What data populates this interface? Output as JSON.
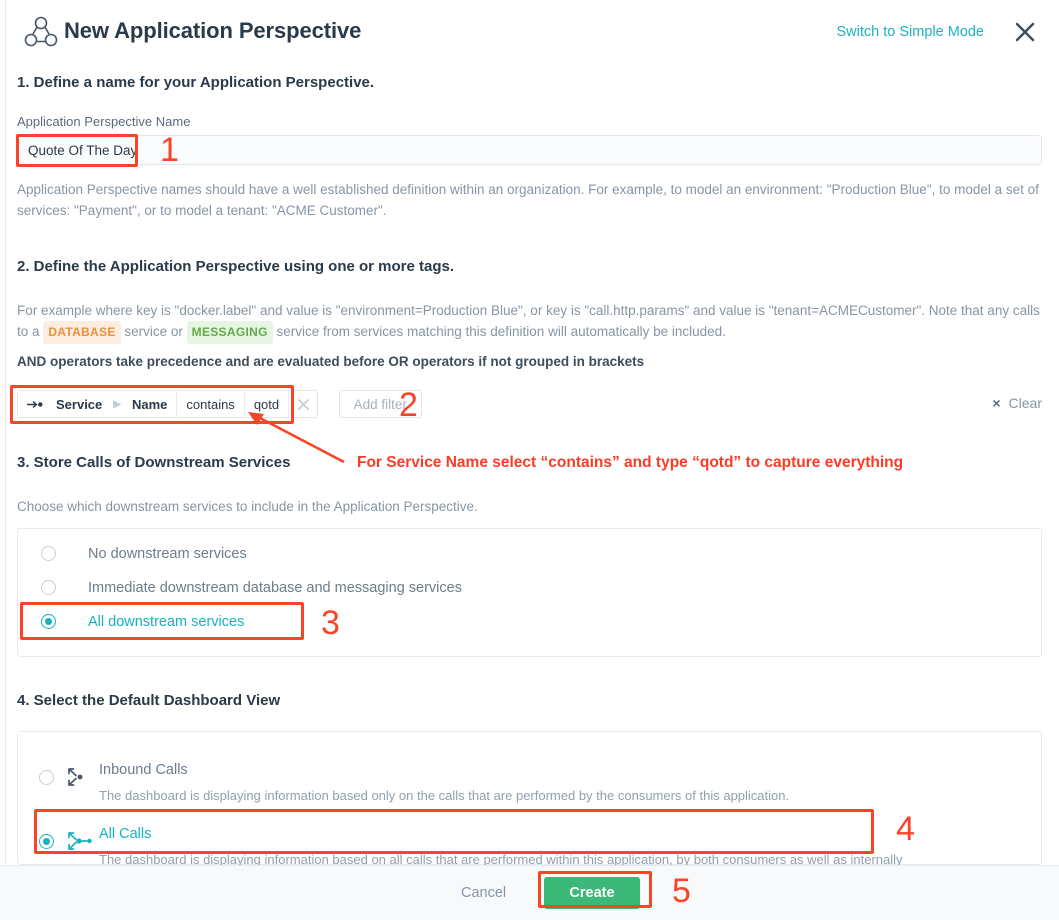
{
  "header": {
    "icon": "perspective-nodes-icon",
    "title": "New Application Perspective",
    "switch_mode_label": "Switch to Simple Mode",
    "close_label": "×"
  },
  "step1": {
    "title": "1. Define a name for your Application Perspective.",
    "field_label": "Application Perspective Name",
    "name_value": "Quote Of The Day",
    "name_placeholder": "Application Perspective Name",
    "helper_line1": "Application Perspective names should have a well established definition within an organization. For example, to model an environment: \"Production Blue\", to model a set of",
    "helper_line2": "services: \"Payment\", or to model a tenant: \"ACME Customer\"."
  },
  "step2": {
    "title": "2. Define the Application Perspective using one or more tags.",
    "helper_a": "For example where key is \"docker.label\" and value is \"environment=Production Blue\", or key is \"call.http.params\" and value is \"tenant=ACMECustomer\". Note that any calls to",
    "helper_b_pre": "a",
    "pill_database": "DATABASE",
    "helper_b_mid": "service or",
    "pill_messaging": "MESSAGING",
    "helper_b_post": "service from services matching this definition will automatically be included.",
    "bold_note": "AND operators take precedence and are evaluated before OR operators if not grouped in brackets",
    "filter": {
      "scope_icon": "call-direction-icon",
      "entity": "Service",
      "separator": "▶",
      "attribute": "Name",
      "operator": "contains",
      "value": "qotd",
      "remove_label": "×"
    },
    "add_filter_label": "Add filter",
    "clear_label": "Clear",
    "clear_icon": "×"
  },
  "step3": {
    "title": "3. Store Calls of Downstream Services",
    "subtitle": "Choose which downstream services to include in the Application Perspective.",
    "options": [
      {
        "label": "No downstream services",
        "selected": false
      },
      {
        "label": "Immediate downstream database and messaging services",
        "selected": false
      },
      {
        "label": "All downstream services",
        "selected": true
      }
    ]
  },
  "step4": {
    "title": "4. Select the Default Dashboard View",
    "options": [
      {
        "icon": "inbound-calls-icon",
        "label": "Inbound Calls",
        "description": "The dashboard is displaying information based only on the calls that are performed by the consumers of this application.",
        "selected": false
      },
      {
        "icon": "all-calls-icon",
        "label": "All Calls",
        "description": "The dashboard is displaying information based on all calls that are performed within this application, by both consumers as well as internally",
        "selected": true
      }
    ]
  },
  "footer": {
    "cancel_label": "Cancel",
    "create_label": "Create"
  },
  "annotations": {
    "n1": "1",
    "n2": "2",
    "n3": "3",
    "n4": "4",
    "n5": "5",
    "callout": "For Service Name select “contains” and type “qotd” to capture everything"
  },
  "colors": {
    "accent_teal": "#16b3bf",
    "annotation_red": "#f9442a",
    "create_green": "#3cb878",
    "database_orange": "#e8913c",
    "messaging_green": "#62ab4a"
  }
}
